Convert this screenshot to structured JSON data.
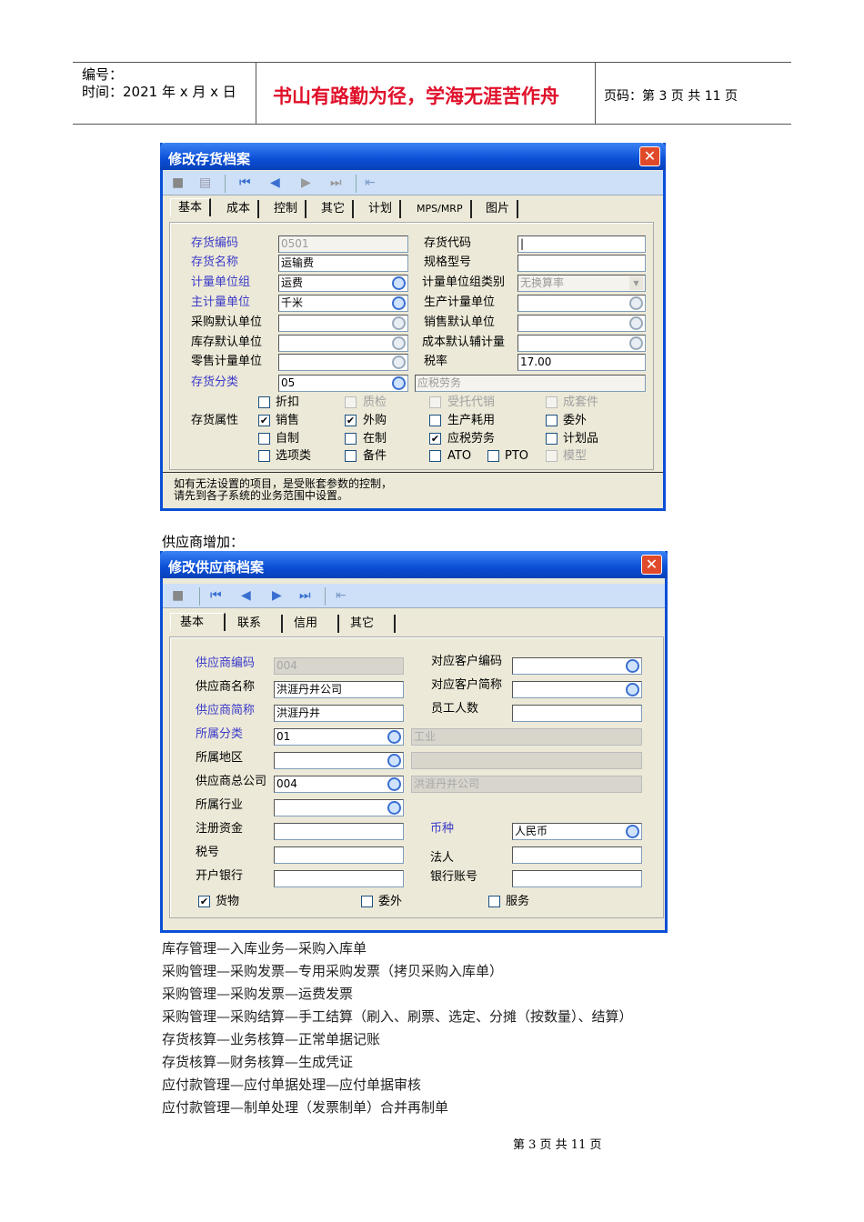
{
  "header": {
    "number_label": "编号：",
    "date_label": "时间：2021 年 x 月 x 日",
    "motto": "书山有路勤为径，学海无涯苦作舟",
    "page_label": "页码：第 3 页  共 11 页"
  },
  "dialog1": {
    "title": "修改存货档案",
    "close": "✕",
    "tabs": [
      "基本",
      "成本",
      "控制",
      "其它",
      "计划",
      "MPS/MRP",
      "图片"
    ],
    "fields_left": [
      {
        "label": "存货编码",
        "value": "0501"
      },
      {
        "label": "存货名称",
        "value": "运输费"
      },
      {
        "label": "计量单位组",
        "value": "运费"
      },
      {
        "label": "主计量单位",
        "value": "千米"
      },
      {
        "label": "采购默认单位",
        "value": ""
      },
      {
        "label": "库存默认单位",
        "value": ""
      },
      {
        "label": "零售计量单位",
        "value": ""
      },
      {
        "label": "存货分类",
        "value": "05"
      }
    ],
    "fields_right": [
      {
        "label": "存货代码",
        "value": "|"
      },
      {
        "label": "规格型号",
        "value": ""
      },
      {
        "label": "计量单位组类别",
        "value": "无换算率"
      },
      {
        "label": "生产计量单位",
        "value": ""
      },
      {
        "label": "销售默认单位",
        "value": ""
      },
      {
        "label": "成本默认辅计量",
        "value": ""
      },
      {
        "label": "税率",
        "value": "17.00"
      }
    ],
    "category_name": "应税劳务",
    "attr_label": "存货属性",
    "checks": [
      {
        "label": "折扣",
        "checked": false
      },
      {
        "label": "质检",
        "checked": false
      },
      {
        "label": "受托代销",
        "checked": false
      },
      {
        "label": "成套件",
        "checked": false
      },
      {
        "label": "销售",
        "checked": true
      },
      {
        "label": "外购",
        "checked": true
      },
      {
        "label": "生产耗用",
        "checked": false
      },
      {
        "label": "委外",
        "checked": false
      },
      {
        "label": "自制",
        "checked": false
      },
      {
        "label": "在制",
        "checked": false
      },
      {
        "label": "应税劳务",
        "checked": true
      },
      {
        "label": "计划品",
        "checked": false
      },
      {
        "label": "选项类",
        "checked": false
      },
      {
        "label": "备件",
        "checked": false
      },
      {
        "label": "ATO",
        "checked": false
      },
      {
        "label": "PTO",
        "checked": false
      },
      {
        "label": "模型",
        "checked": false
      }
    ],
    "note1": "如有无法设置的项目，是受账套参数的控制，",
    "note2": "请先到各子系统的业务范围中设置。"
  },
  "caption": "供应商增加：",
  "dialog2": {
    "title": "修改供应商档案",
    "close": "✕",
    "tabs": [
      "基本",
      "联系",
      "信用",
      "其它"
    ],
    "fields_left": [
      {
        "label": "供应商编码",
        "value": "004"
      },
      {
        "label": "供应商名称",
        "value": "洪涯丹井公司"
      },
      {
        "label": "供应商简称",
        "value": "洪涯丹井"
      },
      {
        "label": "所属分类",
        "value": "01"
      },
      {
        "label": "所属地区",
        "value": ""
      },
      {
        "label": "供应商总公司",
        "value": "004"
      },
      {
        "label": "所属行业",
        "value": ""
      },
      {
        "label": "注册资金",
        "value": ""
      },
      {
        "label": "税号",
        "value": ""
      },
      {
        "label": "开户银行",
        "value": ""
      }
    ],
    "fields_right": [
      {
        "label": "对应客户编码",
        "value": ""
      },
      {
        "label": "对应客户简称",
        "value": ""
      },
      {
        "label": "员工人数",
        "value": ""
      }
    ],
    "class_name": "工业",
    "region_name": "",
    "parent_name": "洪涯丹井公司",
    "currency": {
      "label": "币种",
      "value": "人民币"
    },
    "legal": {
      "label": "法人",
      "value": ""
    },
    "account": {
      "label": "银行账号",
      "value": ""
    },
    "checks": [
      {
        "label": "货物",
        "checked": true
      },
      {
        "label": "委外",
        "checked": false
      },
      {
        "label": "服务",
        "checked": false
      }
    ]
  },
  "steps": [
    "库存管理—入库业务—采购入库单",
    "采购管理—采购发票—专用采购发票（拷贝采购入库单）",
    "采购管理—采购发票—运费发票",
    "采购管理—采购结算—手工结算（刷入、刷票、选定、分摊（按数量）、结算）",
    "存货核算—业务核算—正常单据记账",
    "存货核算—财务核算—生成凭证",
    "应付款管理—应付单据处理—应付单据审核",
    "应付款管理—制单处理（发票制单）合并再制单"
  ],
  "footer": "第 3 页 共 11 页"
}
